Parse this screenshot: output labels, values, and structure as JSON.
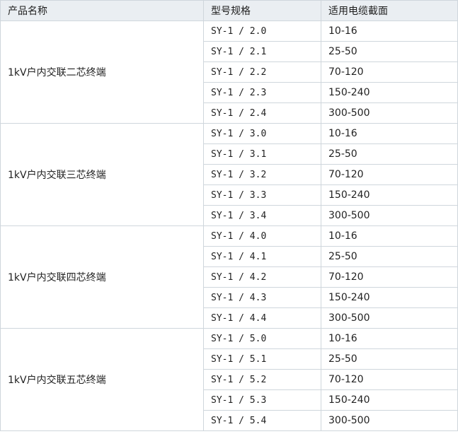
{
  "headers": [
    "产品名称",
    "型号规格",
    "适用电缆截面"
  ],
  "groups": [
    {
      "product": "1kV户内交联二芯终端",
      "rows": [
        {
          "model": "SY-1 / 2.0",
          "section": "10-16"
        },
        {
          "model": "SY-1 / 2.1",
          "section": "25-50"
        },
        {
          "model": "SY-1 / 2.2",
          "section": "70-120"
        },
        {
          "model": "SY-1 / 2.3",
          "section": "150-240"
        },
        {
          "model": "SY-1 / 2.4",
          "section": "300-500"
        }
      ]
    },
    {
      "product": "1kV户内交联三芯终端",
      "rows": [
        {
          "model": "SY-1 / 3.0",
          "section": "10-16"
        },
        {
          "model": "SY-1 / 3.1",
          "section": "25-50"
        },
        {
          "model": "SY-1 / 3.2",
          "section": "70-120"
        },
        {
          "model": "SY-1 / 3.3",
          "section": "150-240"
        },
        {
          "model": "SY-1 / 3.4",
          "section": "300-500"
        }
      ]
    },
    {
      "product": "1kV户内交联四芯终端",
      "rows": [
        {
          "model": "SY-1 / 4.0",
          "section": "10-16"
        },
        {
          "model": "SY-1 / 4.1",
          "section": "25-50"
        },
        {
          "model": "SY-1 / 4.2",
          "section": "70-120"
        },
        {
          "model": "SY-1 / 4.3",
          "section": "150-240"
        },
        {
          "model": "SY-1 / 4.4",
          "section": "300-500"
        }
      ]
    },
    {
      "product": "1kV户内交联五芯终端",
      "rows": [
        {
          "model": "SY-1 / 5.0",
          "section": "10-16"
        },
        {
          "model": "SY-1 / 5.1",
          "section": "25-50"
        },
        {
          "model": "SY-1 / 5.2",
          "section": "70-120"
        },
        {
          "model": "SY-1 / 5.3",
          "section": "150-240"
        },
        {
          "model": "SY-1 / 5.4",
          "section": "300-500"
        }
      ]
    }
  ]
}
